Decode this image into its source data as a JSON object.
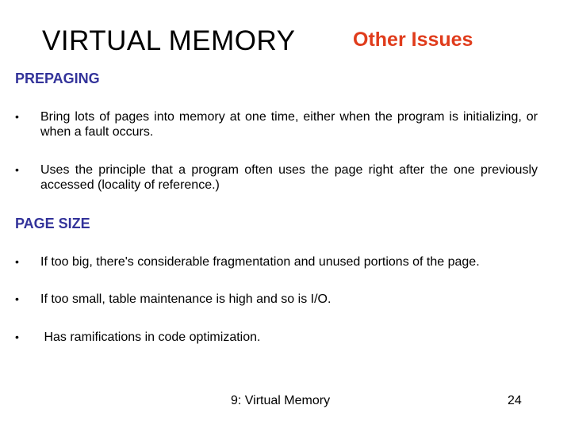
{
  "slide": {
    "title": "VIRTUAL MEMORY",
    "subtitle": "Other Issues",
    "colors": {
      "title": "#000000",
      "subtitle": "#e03c1c",
      "section_heading": "#33339a",
      "body_text": "#000000",
      "background": "#ffffff"
    }
  },
  "sections": [
    {
      "heading": "PREPAGING",
      "bullets": [
        {
          "marker": "•",
          "text": "Bring lots of pages into memory at one time, either when the program is initializing, or when a fault occurs."
        },
        {
          "marker": "•",
          "text": "Uses the principle that a program often uses the page right after the one previously accessed (locality of reference.)"
        }
      ]
    },
    {
      "heading": "PAGE SIZE",
      "bullets": [
        {
          "marker": "•",
          "text": "If too big, there's considerable fragmentation and unused portions of the page."
        },
        {
          "marker": "•",
          "text": "If too small, table maintenance is high and so is I/O."
        },
        {
          "marker": "•",
          "text": " Has ramifications in code optimization."
        }
      ]
    }
  ],
  "footer": {
    "chapter": "9: Virtual Memory",
    "page_number": "24"
  }
}
